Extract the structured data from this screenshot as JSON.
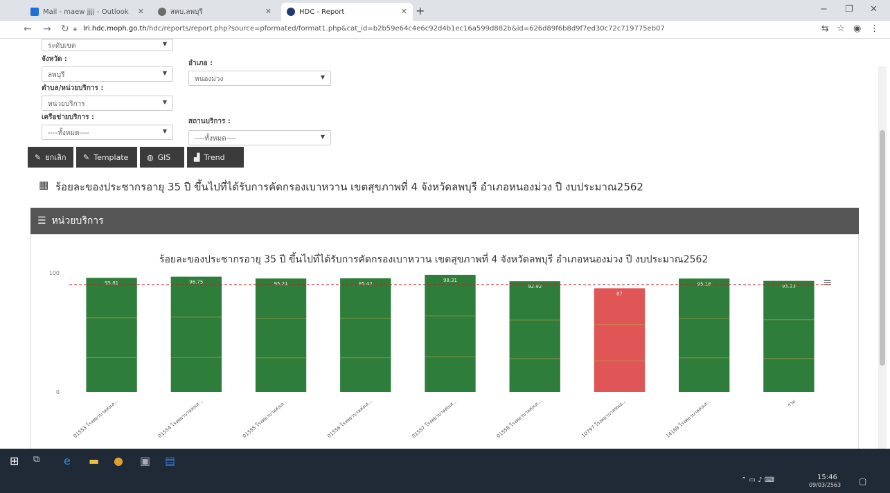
{
  "browser": {
    "tabs": [
      {
        "title": "Mail - maew jjjj - Outlook",
        "color": "#1e6fd9"
      },
      {
        "title": "สคบ.ลพบุรี",
        "color": "#6d6d6d"
      },
      {
        "title": "HDC - Report",
        "color": "#1c3b6e"
      }
    ],
    "new_tab": "+",
    "url_host": "lri.hdc.moph.go.th",
    "url_path": "/hdc/reports/report.php?source=pformated/format1.php&cat_id=b2b59e64c4e6c92d4b1ec16a599d882b&id=626d89f6b8d9f7ed30c72c719775eb07"
  },
  "form": {
    "province_label": "จังหวัด :",
    "province_value": "ลพบุรี",
    "district_label": "อำเภอ :",
    "district_value": "หนองม่วง",
    "subdistrict_label": "ตำบล/หน่วยบริการ :",
    "subdistrict_value": "หน่วยบริการ",
    "network_label": "เครือข่ายบริการ :",
    "network_value": "----ทั้งหมด----",
    "facility_label": "สถานบริการ :",
    "facility_value": "----ทั้งหมด----",
    "top_select_value": "ระดับเขต"
  },
  "buttons": {
    "detail": "ยกเลิก",
    "template": "Template",
    "gis": "GIS",
    "trend": "Trend"
  },
  "report_title": "ร้อยละของประชากรอายุ 35 ปี ขึ้นไปที่ได้รับการคัดกรองเบาหวาน เขตสุขภาพที่ 4 จังหวัดลพบุรี อำเภอหนองม่วง ปี งบประมาณ2562",
  "panel_title": "หน่วยบริการ",
  "chart_data": {
    "type": "bar",
    "title": "ร้อยละของประชากรอายุ 35 ปี ขึ้นไปที่ได้รับการคัดกรองเบาหวาน เขตสุขภาพที่ 4 จังหวัดลพบุรี อำเภอหนองม่วง ปี งบประมาณ2562",
    "categories": [
      "01553 โรงพยาบาลส่งเส...",
      "01554 โรงพยาบาลส่งเส...",
      "01555 โรงพยาบาลส่งเส...",
      "01556 โรงพยาบาลส่งเส...",
      "01557 โรงพยาบาลส่งเส...",
      "01558 โรงพยาบาลส่งเส...",
      "10797 โรงพยาบาลหนอ...",
      "14169 โรงพยาบาลส่งเส...",
      "รวม"
    ],
    "values": [
      95.81,
      96.75,
      95.21,
      95.42,
      98.31,
      92.92,
      87,
      95.18,
      93.23
    ],
    "value_labels": [
      "95.81",
      "96.75",
      "95.21",
      "95.42",
      "98.31",
      "92.92",
      "87",
      "95.18",
      "93.23"
    ],
    "ylim": [
      0,
      100
    ],
    "y_ticks": [
      "0",
      "100"
    ],
    "target": 90,
    "colors": {
      "pass": "#2e7d3a",
      "fail": "#e05555",
      "target_line": "#cc2222"
    },
    "menu_icon": "hamburger-icon"
  },
  "taskbar": {
    "time": "15:46",
    "date": "09/03/2563"
  }
}
